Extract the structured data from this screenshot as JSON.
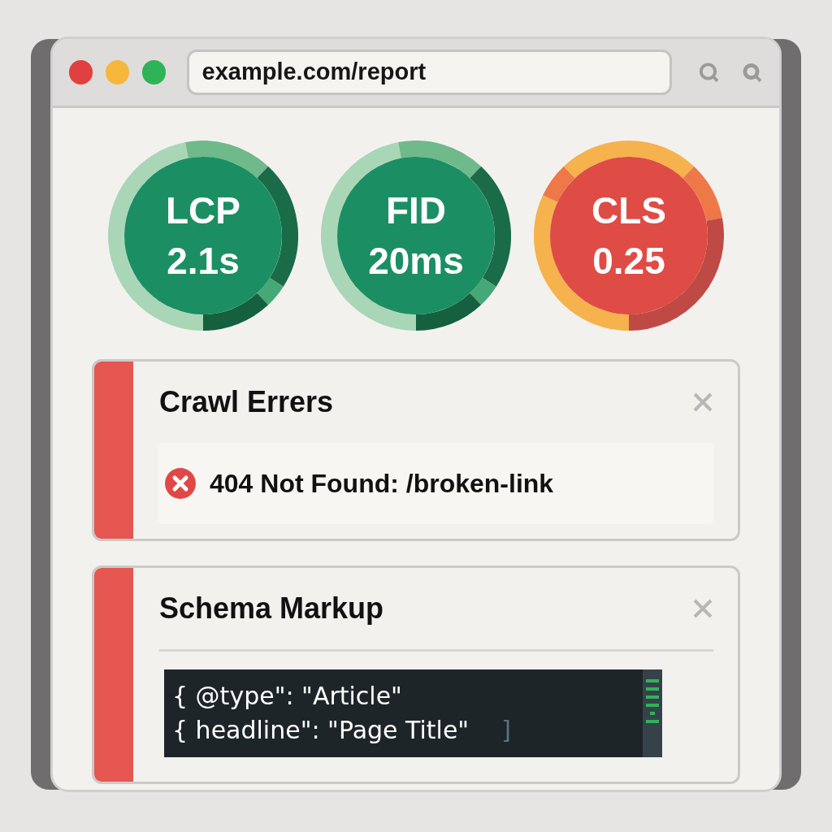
{
  "browser": {
    "url": "example.com/report"
  },
  "metrics": [
    {
      "label": "LCP",
      "value": "2.1s",
      "kind": "good"
    },
    {
      "label": "FID",
      "value": "20ms",
      "kind": "good"
    },
    {
      "label": "CLS",
      "value": "0.25",
      "kind": "poor"
    }
  ],
  "cards": [
    {
      "title": "Crawl Errers",
      "kind": "error",
      "message": "404 Not Found: /broken-link"
    },
    {
      "title": "Schema Markup",
      "kind": "code",
      "lines": [
        "{ @type\": \"Article\"",
        "{ headline\": \"Page Title\""
      ],
      "closing": "]"
    }
  ]
}
